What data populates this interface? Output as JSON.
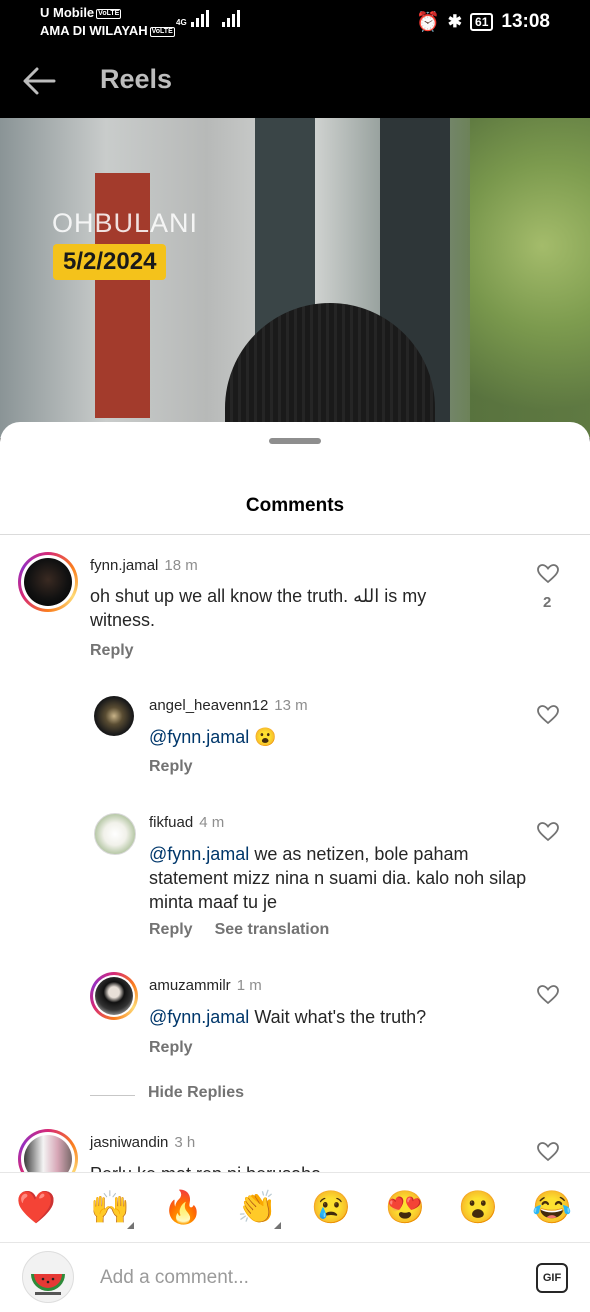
{
  "status_bar": {
    "carrier": "U Mobile",
    "carrier_line2": "AMA DI WILAYAH",
    "volte": "VoLTE",
    "network": "4G",
    "battery": "61",
    "time": "13:08"
  },
  "topbar": {
    "title": "Reels"
  },
  "video": {
    "watermark": "OHBULANI",
    "date": "5/2/2024"
  },
  "sheet": {
    "title": "Comments"
  },
  "comments": [
    {
      "username": "fynn.jamal",
      "time": "18 m",
      "text": "oh shut up we all know the truth. الله is my witness.",
      "likes": "2",
      "reply_label": "Reply"
    },
    {
      "username": "angel_heavenn12",
      "time": "13 m",
      "mention": "@fynn.jamal",
      "text": "😮",
      "reply_label": "Reply"
    },
    {
      "username": "fikfuad",
      "time": "4 m",
      "mention": "@fynn.jamal",
      "text": "we as netizen, bole paham statement mizz nina n suami dia. kalo noh silap minta maaf tu je",
      "reply_label": "Reply",
      "translate_label": "See translation"
    },
    {
      "username": "amuzammilr",
      "time": "1 m",
      "mention": "@fynn.jamal",
      "text": "Wait what's the truth?",
      "reply_label": "Reply"
    },
    {
      "username": "jasniwandin",
      "time": "3 h",
      "text": "Perlu ke mat rep ni berusaha"
    }
  ],
  "hide_replies": "Hide Replies",
  "emojis": [
    "❤️",
    "🙌",
    "🔥",
    "👏",
    "😢",
    "😍",
    "😮",
    "😂"
  ],
  "input": {
    "placeholder": "Add a comment...",
    "gif_label": "GIF"
  },
  "colors": {
    "mention": "#00376b",
    "heart": "#ed4956",
    "secondary_text": "#737373"
  }
}
